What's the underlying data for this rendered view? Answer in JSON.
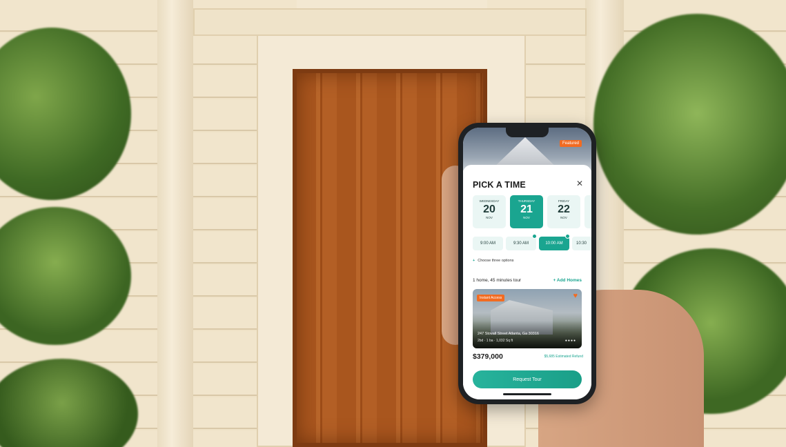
{
  "featured_badge": "Featured",
  "sheet": {
    "title": "PICK A TIME",
    "close_icon": "close-icon",
    "dates": [
      {
        "weekday": "WEDNESDAY",
        "day": "20",
        "month": "NOV",
        "selected": false
      },
      {
        "weekday": "THURSDAY",
        "day": "21",
        "month": "NOV",
        "selected": true
      },
      {
        "weekday": "FRIDAY",
        "day": "22",
        "month": "NOV",
        "selected": false
      }
    ],
    "times": [
      {
        "label": "9:00 AM",
        "selected": false
      },
      {
        "label": "9:30 AM",
        "selected": false
      },
      {
        "label": "10:00 AM",
        "selected": true
      },
      {
        "label": "10:30",
        "selected": false
      }
    ],
    "choose_label": "Choose three options",
    "tour_info": "1 home, 45 minutes tour",
    "add_homes": "+ Add Homes",
    "listing": {
      "badge": "Instant Access",
      "address": "247 Stovall Street Atlanta, Ga 30316",
      "specs": "2bd · 1 ba · 1,032 Sq ft",
      "dots": "●●●●",
      "price": "$379,000",
      "refund": "$5,685 Estimated Refund"
    },
    "cta": "Request Tour"
  },
  "colors": {
    "accent": "#1aa590",
    "orange": "#f26b21"
  }
}
